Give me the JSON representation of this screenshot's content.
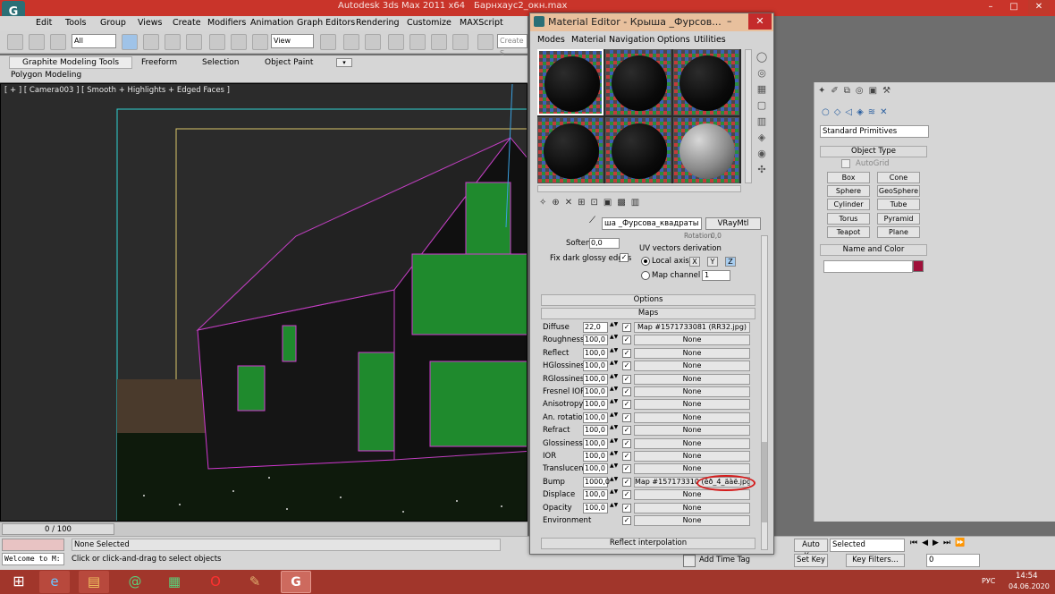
{
  "app": {
    "title": "Autodesk 3ds Max  2011 x64",
    "file": "Барнхаус2_окн.max",
    "menu": [
      "Edit",
      "Tools",
      "Group",
      "Views",
      "Create",
      "Modifiers",
      "Animation",
      "Graph Editors",
      "Rendering",
      "Customize",
      "MAXScript"
    ],
    "selection_filter": "All",
    "ref_coord": "View",
    "create_selection": "Create S"
  },
  "ribbon": {
    "tabs": [
      "Graphite Modeling Tools",
      "Freeform",
      "Selection",
      "Object Paint"
    ],
    "sub": "Polygon Modeling"
  },
  "viewport": {
    "label": "[ + ] [ Camera003 ] [ Smooth + Highlights + Edged Faces ]"
  },
  "timeline": {
    "frame": "0 / 100"
  },
  "status": {
    "selection": "None Selected",
    "prompt": "Click or click-and-drag to select objects",
    "script": "Welcome to M:",
    "add_time_tag": "Add Time Tag",
    "auto_key": "Auto Key",
    "set_key": "Set Key",
    "key_mode": "Selected",
    "key_filters": "Key Filters...",
    "frame_field": "0"
  },
  "taskbar": {
    "lang": "РУС",
    "time": "14:54",
    "date": "04.06.2020"
  },
  "command_panel": {
    "category": "Standard Primitives",
    "object_type": "Object Type",
    "autogrid": "AutoGrid",
    "buttons": [
      "Box",
      "Cone",
      "Sphere",
      "GeoSphere",
      "Cylinder",
      "Tube",
      "Torus",
      "Pyramid",
      "Teapot",
      "Plane"
    ],
    "name_color": "Name and Color",
    "swatch": "#a0103a"
  },
  "material_editor": {
    "title": "Material Editor - Крыша _Фурсов...",
    "menu": [
      "Modes",
      "Material",
      "Navigation",
      "Options",
      "Utilities"
    ],
    "material_name": "ша _Фурсова_квадраты",
    "material_type": "VRayMtl",
    "rotation_label": "Rotation",
    "rotation_value": "0,0",
    "soften_label": "Soften",
    "soften_value": "0,0",
    "fix_dark": "Fix dark glossy edges",
    "uv_title": "UV vectors derivation",
    "local_axis": "Local axis",
    "axes": [
      "X",
      "Y",
      "Z"
    ],
    "map_channel": "Map channel",
    "map_channel_value": "1",
    "rollouts": {
      "options": "Options",
      "maps": "Maps",
      "reflect_interp": "Reflect interpolation"
    },
    "maps": [
      {
        "label": "Diffuse",
        "value": "22,0",
        "map": "Map #1571733081 (RR32.jpg)"
      },
      {
        "label": "Roughness",
        "value": "100,0",
        "map": "None"
      },
      {
        "label": "Reflect",
        "value": "100,0",
        "map": "None"
      },
      {
        "label": "HGlossiness",
        "value": "100,0",
        "map": "None"
      },
      {
        "label": "RGlossiness",
        "value": "100,0",
        "map": "None"
      },
      {
        "label": "Fresnel IOR",
        "value": "100,0",
        "map": "None"
      },
      {
        "label": "Anisotropy",
        "value": "100,0",
        "map": "None"
      },
      {
        "label": "An. rotation",
        "value": "100,0",
        "map": "None"
      },
      {
        "label": "Refract",
        "value": "100,0",
        "map": "None"
      },
      {
        "label": "Glossiness",
        "value": "100,0",
        "map": "None"
      },
      {
        "label": "IOR",
        "value": "100,0",
        "map": "None"
      },
      {
        "label": "Translucent",
        "value": "100,0",
        "map": "None"
      },
      {
        "label": "Bump",
        "value": "1000,0",
        "map": "Map #157173310 (êð_4_äàë.jpg)"
      },
      {
        "label": "Displace",
        "value": "100,0",
        "map": "None"
      },
      {
        "label": "Opacity",
        "value": "100,0",
        "map": "None"
      },
      {
        "label": "Environment",
        "value": "",
        "map": "None"
      }
    ],
    "highlight_color": "#d41c1c"
  }
}
